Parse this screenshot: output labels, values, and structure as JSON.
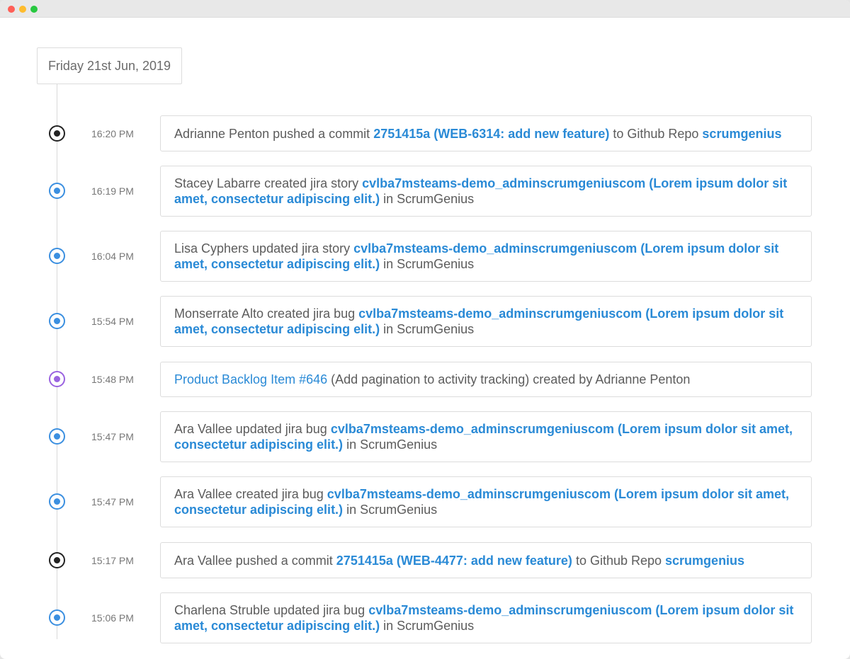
{
  "date_label": "Friday 21st Jun, 2019",
  "entries": [
    {
      "type": "commit",
      "time": "16:20 PM",
      "actor": "Adrianne Penton",
      "action": " pushed a commit ",
      "link": "2751415a (WEB-6314: add new feature)",
      "mid": " to Github Repo ",
      "link2": "scrumgenius",
      "tail": ""
    },
    {
      "type": "jira",
      "time": "16:19 PM",
      "actor": "Stacey Labarre",
      "action": " created jira story ",
      "link": "cvlba7msteams-demo_adminscrumgeniuscom (Lorem ipsum dolor sit amet, consectetur adipiscing elit.)",
      "mid": " in ScrumGenius",
      "link2": "",
      "tail": ""
    },
    {
      "type": "jira",
      "time": "16:04 PM",
      "actor": "Lisa Cyphers",
      "action": " updated jira story ",
      "link": "cvlba7msteams-demo_adminscrumgeniuscom (Lorem ipsum dolor sit amet, consectetur adipiscing elit.)",
      "mid": " in ScrumGenius",
      "link2": "",
      "tail": ""
    },
    {
      "type": "jira",
      "time": "15:54 PM",
      "actor": "Monserrate Alto",
      "action": " created jira bug ",
      "link": "cvlba7msteams-demo_adminscrumgeniuscom (Lorem ipsum dolor sit amet, consectetur adipiscing elit.)",
      "mid": " in ScrumGenius",
      "link2": "",
      "tail": ""
    },
    {
      "type": "pbi",
      "time": "15:48 PM",
      "link": "Product Backlog Item #646",
      "tail": " (Add pagination to activity tracking) created by Adrianne Penton"
    },
    {
      "type": "jira",
      "time": "15:47 PM",
      "actor": "Ara Vallee",
      "action": " updated jira bug ",
      "link": "cvlba7msteams-demo_adminscrumgeniuscom (Lorem ipsum dolor sit amet, consectetur adipiscing elit.)",
      "mid": " in ScrumGenius",
      "link2": "",
      "tail": ""
    },
    {
      "type": "jira",
      "time": "15:47 PM",
      "actor": "Ara Vallee",
      "action": " created jira bug ",
      "link": "cvlba7msteams-demo_adminscrumgeniuscom (Lorem ipsum dolor sit amet, consectetur adipiscing elit.)",
      "mid": " in ScrumGenius",
      "link2": "",
      "tail": ""
    },
    {
      "type": "commit",
      "time": "15:17 PM",
      "actor": "Ara Vallee",
      "action": " pushed a commit ",
      "link": "2751415a (WEB-4477: add new feature)",
      "mid": " to Github Repo ",
      "link2": "scrumgenius",
      "tail": ""
    },
    {
      "type": "jira",
      "time": "15:06 PM",
      "actor": "Charlena Struble",
      "action": " updated jira bug ",
      "link": "cvlba7msteams-demo_adminscrumgeniuscom (Lorem ipsum dolor sit amet, consectetur adipiscing elit.)",
      "mid": " in ScrumGenius",
      "link2": "",
      "tail": ""
    }
  ]
}
